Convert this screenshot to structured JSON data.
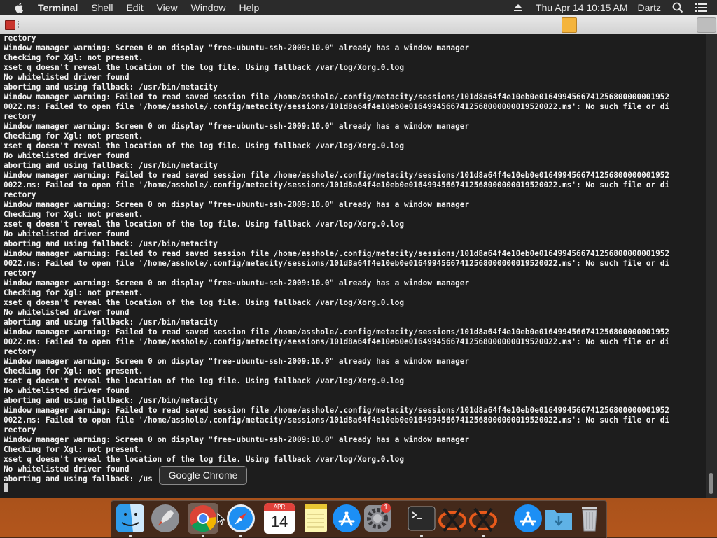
{
  "menubar": {
    "app_name": "Terminal",
    "items": [
      "Shell",
      "Edit",
      "View",
      "Window",
      "Help"
    ],
    "clock": "Thu Apr 14  10:15 AM",
    "user": "Dartz"
  },
  "terminal": {
    "lines": [
      "rectory",
      "Window manager warning: Screen 0 on display \"free-ubuntu-ssh-2009:10.0\" already has a window manager",
      "Checking for Xgl: not present.",
      "xset q doesn't reveal the location of the log file. Using fallback /var/log/Xorg.0.log",
      "No whitelisted driver found",
      "aborting and using fallback: /usr/bin/metacity",
      "Window manager warning: Failed to read saved session file /home/asshole/.config/metacity/sessions/101d8a64f4e10eb0e0164994566741256800000001952",
      "0022.ms: Failed to open file '/home/asshole/.config/metacity/sessions/101d8a64f4e10eb0e01649945667412568000000019520022.ms': No such file or di",
      "rectory",
      "Window manager warning: Screen 0 on display \"free-ubuntu-ssh-2009:10.0\" already has a window manager",
      "Checking for Xgl: not present.",
      "xset q doesn't reveal the location of the log file. Using fallback /var/log/Xorg.0.log",
      "No whitelisted driver found",
      "aborting and using fallback: /usr/bin/metacity",
      "Window manager warning: Failed to read saved session file /home/asshole/.config/metacity/sessions/101d8a64f4e10eb0e0164994566741256800000001952",
      "0022.ms: Failed to open file '/home/asshole/.config/metacity/sessions/101d8a64f4e10eb0e01649945667412568000000019520022.ms': No such file or di",
      "rectory",
      "Window manager warning: Screen 0 on display \"free-ubuntu-ssh-2009:10.0\" already has a window manager",
      "Checking for Xgl: not present.",
      "xset q doesn't reveal the location of the log file. Using fallback /var/log/Xorg.0.log",
      "No whitelisted driver found",
      "aborting and using fallback: /usr/bin/metacity",
      "Window manager warning: Failed to read saved session file /home/asshole/.config/metacity/sessions/101d8a64f4e10eb0e0164994566741256800000001952",
      "0022.ms: Failed to open file '/home/asshole/.config/metacity/sessions/101d8a64f4e10eb0e01649945667412568000000019520022.ms': No such file or di",
      "rectory",
      "Window manager warning: Screen 0 on display \"free-ubuntu-ssh-2009:10.0\" already has a window manager",
      "Checking for Xgl: not present.",
      "xset q doesn't reveal the location of the log file. Using fallback /var/log/Xorg.0.log",
      "No whitelisted driver found",
      "aborting and using fallback: /usr/bin/metacity",
      "Window manager warning: Failed to read saved session file /home/asshole/.config/metacity/sessions/101d8a64f4e10eb0e0164994566741256800000001952",
      "0022.ms: Failed to open file '/home/asshole/.config/metacity/sessions/101d8a64f4e10eb0e01649945667412568000000019520022.ms': No such file or di",
      "rectory",
      "Window manager warning: Screen 0 on display \"free-ubuntu-ssh-2009:10.0\" already has a window manager",
      "Checking for Xgl: not present.",
      "xset q doesn't reveal the location of the log file. Using fallback /var/log/Xorg.0.log",
      "No whitelisted driver found",
      "aborting and using fallback: /usr/bin/metacity",
      "Window manager warning: Failed to read saved session file /home/asshole/.config/metacity/sessions/101d8a64f4e10eb0e0164994566741256800000001952",
      "0022.ms: Failed to open file '/home/asshole/.config/metacity/sessions/101d8a64f4e10eb0e01649945667412568000000019520022.ms': No such file or di",
      "rectory",
      "Window manager warning: Screen 0 on display \"free-ubuntu-ssh-2009:10.0\" already has a window manager",
      "Checking for Xgl: not present.",
      "xset q doesn't reveal the location of the log file. Using fallback /var/log/Xorg.0.log",
      "No whitelisted driver found",
      "aborting and using fallback: /us"
    ]
  },
  "tooltip": {
    "label": "Google Chrome"
  },
  "dock": {
    "calendar_month": "APR",
    "calendar_day": "14",
    "badge_count": "1"
  },
  "colors": {
    "menubar_bg": "#2b2b2b",
    "terminal_bg": "#1d1d1d",
    "terminal_text": "#f2f2f2",
    "badge": "#e0413a"
  }
}
